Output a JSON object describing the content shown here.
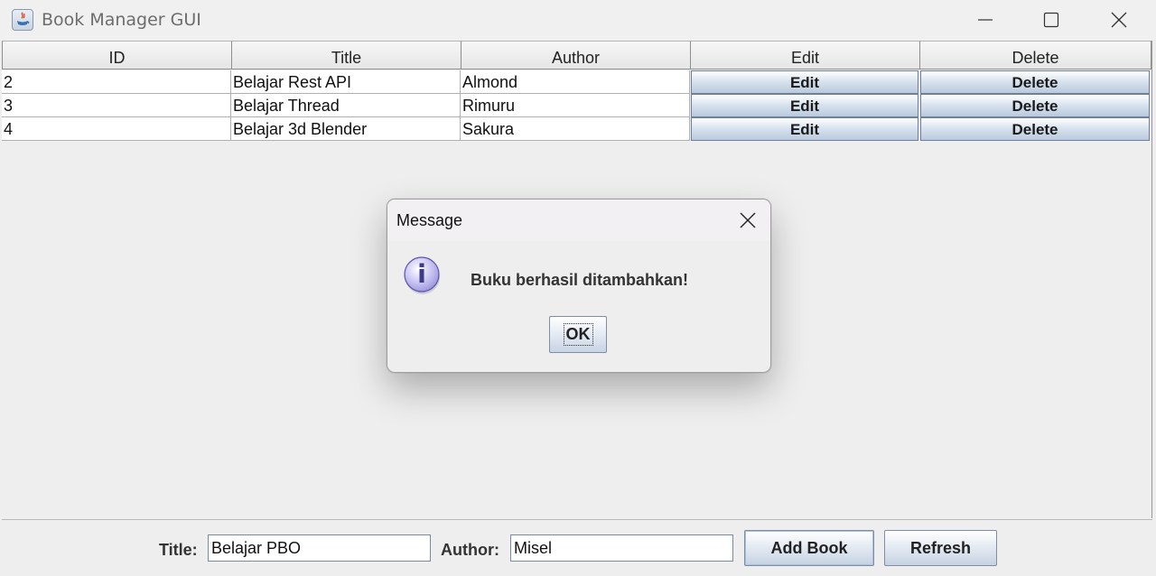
{
  "window": {
    "title": "Book Manager GUI",
    "icon": "java-icon",
    "controls": [
      "minimize-icon",
      "maximize-icon",
      "close-icon"
    ]
  },
  "table": {
    "headers": [
      "ID",
      "Title",
      "Author",
      "Edit",
      "Delete"
    ],
    "rows": [
      {
        "id": "2",
        "title": "Belajar Rest API",
        "author": "Almond",
        "edit": "Edit",
        "delete": "Delete"
      },
      {
        "id": "3",
        "title": "Belajar Thread",
        "author": "Rimuru",
        "edit": "Edit",
        "delete": "Delete"
      },
      {
        "id": "4",
        "title": "Belajar 3d Blender",
        "author": "Sakura",
        "edit": "Edit",
        "delete": "Delete"
      }
    ]
  },
  "form": {
    "title_label": "Title:",
    "title_value": "Belajar PBO",
    "author_label": "Author:",
    "author_value": "Misel",
    "add_button": "Add Book",
    "refresh_button": "Refresh"
  },
  "dialog": {
    "title": "Message",
    "icon": "info-icon",
    "message": "Buku berhasil ditambahkan!",
    "ok_label": "OK"
  }
}
